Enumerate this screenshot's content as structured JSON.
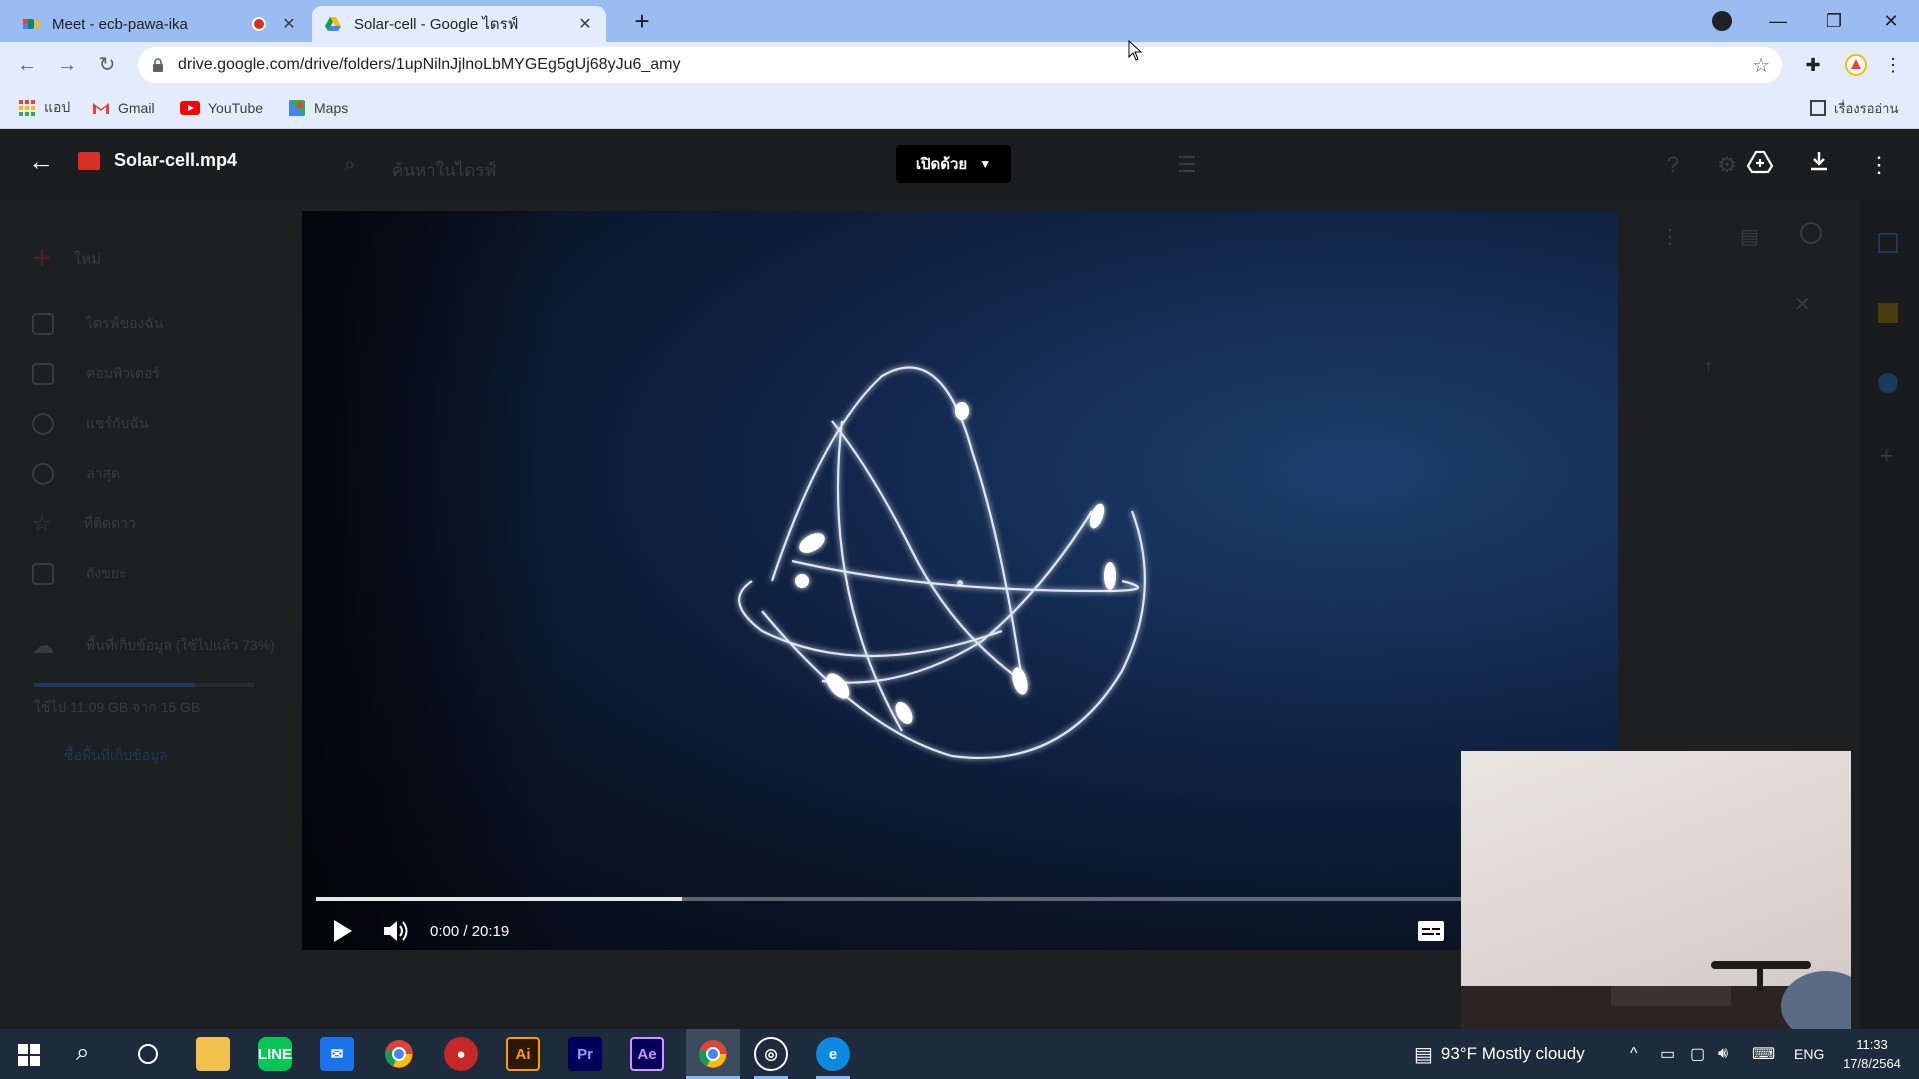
{
  "browser": {
    "tabs": [
      {
        "title": "Meet - ecb-pawa-ika",
        "recording": true
      },
      {
        "title": "Solar-cell - Google ไดรฟ์",
        "active": true
      }
    ],
    "url": "drive.google.com/drive/folders/1upNilnJjlnoLbMYGEg5gUj68yJu6_amy",
    "bookmarks": [
      "แอป",
      "Gmail",
      "YouTube",
      "Maps"
    ],
    "reading_list": "เรื่องรออ่าน"
  },
  "viewer": {
    "file_name": "Solar-cell.mp4",
    "open_with": "เปิดด้วย",
    "search_placeholder": "ค้นหาในไดรฟ์"
  },
  "sidebar": {
    "new_label": "ใหม่",
    "items": [
      "ไดรฟ์ของฉัน",
      "คอมพิวเตอร์",
      "แชร์กับฉัน",
      "ล่าสุด",
      "ที่ติดดาว",
      "ถังขยะ"
    ],
    "storage_label": "พื้นที่เก็บข้อมูล (ใช้ไปแล้ว 73%)",
    "storage_usage": "ใช้ไป 11.09 GB จาก 15 GB",
    "storage_fraction": 0.73,
    "buy_storage": "ซื้อพื้นที่เก็บข้อมูล"
  },
  "player": {
    "time": "0:00 / 20:19",
    "progress_fraction": 0.31
  },
  "taskbar": {
    "weather": "93°F  Mostly cloudy",
    "language": "ENG",
    "clock_time": "11:33",
    "clock_date": "17/8/2564",
    "apps": [
      "Ai",
      "Pr",
      "Ae"
    ]
  },
  "colors": {
    "tabbar": "#9bbcf0",
    "video_accent": "#1d3f6e",
    "record_red": "#d93025"
  }
}
